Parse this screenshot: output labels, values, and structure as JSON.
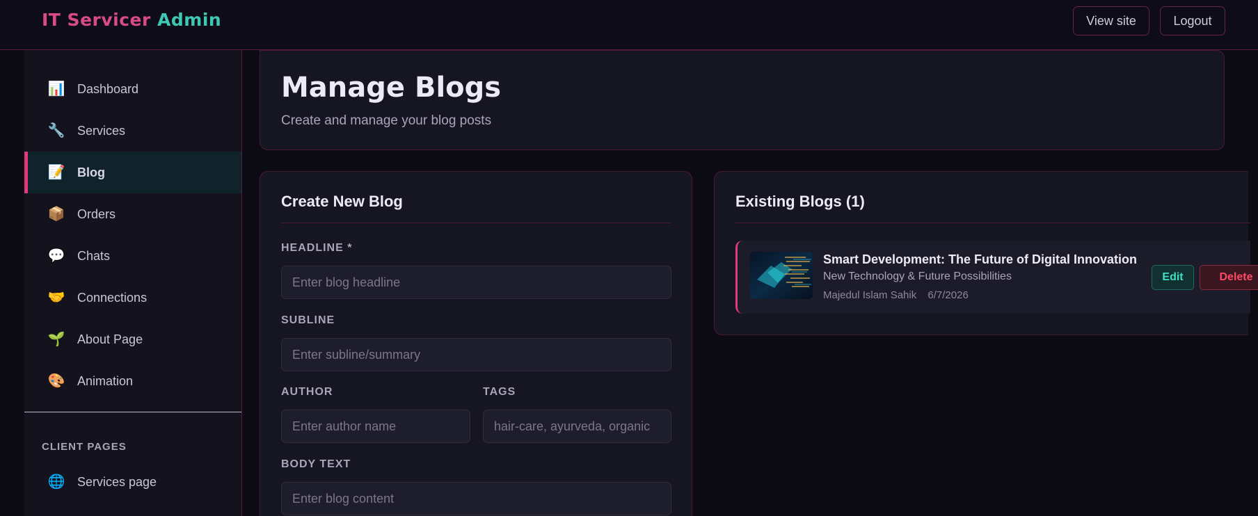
{
  "header": {
    "brand_part1": "IT Servicer",
    "brand_part2": "Admin",
    "view_site": "View site",
    "logout": "Logout"
  },
  "sidebar": {
    "items": [
      {
        "label": "Dashboard",
        "icon": "bar-chart-icon"
      },
      {
        "label": "Services",
        "icon": "wrench-icon"
      },
      {
        "label": "Blog",
        "icon": "memo-icon",
        "active": true
      },
      {
        "label": "Orders",
        "icon": "package-icon"
      },
      {
        "label": "Chats",
        "icon": "speech-bubble-icon"
      },
      {
        "label": "Connections",
        "icon": "handshake-icon"
      },
      {
        "label": "About Page",
        "icon": "seedling-icon"
      },
      {
        "label": "Animation",
        "icon": "palette-icon"
      }
    ],
    "section_title": "CLIENT PAGES",
    "client_items": [
      {
        "label": "Services page",
        "icon": "globe-icon"
      }
    ]
  },
  "page": {
    "title": "Manage Blogs",
    "subtitle": "Create and manage your blog posts"
  },
  "create_form": {
    "title": "Create New Blog",
    "headline_label": "HEADLINE *",
    "headline_placeholder": "Enter blog headline",
    "subline_label": "SUBLINE",
    "subline_placeholder": "Enter subline/summary",
    "author_label": "AUTHOR",
    "author_placeholder": "Enter author name",
    "tags_label": "TAGS",
    "tags_placeholder": "hair-care, ayurveda, organic",
    "body_label": "BODY TEXT",
    "body_placeholder": "Enter blog content"
  },
  "existing": {
    "title": "Existing Blogs (1)",
    "blogs": [
      {
        "title": "Smart Development: The Future of Digital Innovation",
        "subtitle": "New Technology & Future Possibilities",
        "author": "Majedul Islam Sahik",
        "date": "6/7/2026",
        "edit_label": "Edit",
        "delete_label": "Delete"
      }
    ]
  }
}
